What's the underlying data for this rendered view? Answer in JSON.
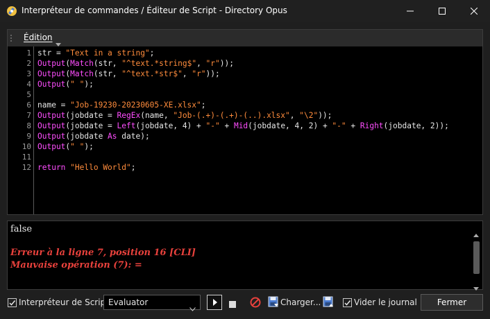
{
  "window": {
    "title": "Interpréteur de commandes / Éditeur de Script - Directory Opus"
  },
  "menu": {
    "edition_label": "Édition"
  },
  "editor": {
    "line_numbers": [
      "1",
      "2",
      "3",
      "4",
      "5",
      "6",
      "7",
      "8",
      "9",
      "10",
      "11",
      "12"
    ],
    "lines": [
      [
        [
          "plain",
          "str = "
        ],
        [
          "str",
          "\"Text in a string\""
        ],
        [
          "plain",
          ";"
        ]
      ],
      [
        [
          "func",
          "Output"
        ],
        [
          "plain",
          "("
        ],
        [
          "func",
          "Match"
        ],
        [
          "plain",
          "(str, "
        ],
        [
          "str",
          "\"^text.*string$\""
        ],
        [
          "plain",
          ", "
        ],
        [
          "str",
          "\"r\""
        ],
        [
          "plain",
          "));"
        ]
      ],
      [
        [
          "func",
          "Output"
        ],
        [
          "plain",
          "("
        ],
        [
          "func",
          "Match"
        ],
        [
          "plain",
          "(str, "
        ],
        [
          "str",
          "\"^text.*str$\""
        ],
        [
          "plain",
          ", "
        ],
        [
          "str",
          "\"r\""
        ],
        [
          "plain",
          "));"
        ]
      ],
      [
        [
          "func",
          "Output"
        ],
        [
          "plain",
          "("
        ],
        [
          "str",
          "\" \""
        ],
        [
          "plain",
          ");"
        ]
      ],
      [],
      [
        [
          "plain",
          "name = "
        ],
        [
          "str",
          "\"Job-19230-20230605-XE.xlsx\""
        ],
        [
          "plain",
          ";"
        ]
      ],
      [
        [
          "func",
          "Output"
        ],
        [
          "plain",
          "(jobdate = "
        ],
        [
          "func",
          "RegEx"
        ],
        [
          "plain",
          "(name, "
        ],
        [
          "str",
          "\"Job-(.+)-(.+)-(..).xlsx\""
        ],
        [
          "plain",
          ", "
        ],
        [
          "str",
          "\"\\2\""
        ],
        [
          "plain",
          "));"
        ]
      ],
      [
        [
          "func",
          "Output"
        ],
        [
          "plain",
          "(jobdate = "
        ],
        [
          "func",
          "Left"
        ],
        [
          "plain",
          "(jobdate, 4) + "
        ],
        [
          "str",
          "\"-\""
        ],
        [
          "plain",
          " + "
        ],
        [
          "func",
          "Mid"
        ],
        [
          "plain",
          "(jobdate, 4, 2) + "
        ],
        [
          "str",
          "\"-\""
        ],
        [
          "plain",
          " + "
        ],
        [
          "func",
          "Right"
        ],
        [
          "plain",
          "(jobdate, 2));"
        ]
      ],
      [
        [
          "func",
          "Output"
        ],
        [
          "plain",
          "(jobdate "
        ],
        [
          "kw",
          "As"
        ],
        [
          "plain",
          " date);"
        ]
      ],
      [
        [
          "func",
          "Output"
        ],
        [
          "plain",
          "("
        ],
        [
          "str",
          "\" \""
        ],
        [
          "plain",
          ");"
        ]
      ],
      [],
      [
        [
          "kw",
          "return"
        ],
        [
          "plain",
          " "
        ],
        [
          "str",
          "\"Hello World\""
        ],
        [
          "plain",
          ";"
        ]
      ]
    ]
  },
  "console": {
    "output_line": "false",
    "error_line_1": "Erreur à la ligne 7, position 16 [CLI]",
    "error_line_2": "Mauvaise opération (7): ="
  },
  "bottombar": {
    "script_interpreter_label": "Interpréteur de Script:",
    "script_interpreter_checked": true,
    "mode_value": "Evaluator",
    "load_label": "Charger...",
    "clear_log_label": "Vider le journal",
    "clear_log_checked": true,
    "close_label": "Fermer"
  },
  "colors": {
    "string": "#ff8c3c",
    "function": "#ff4dff",
    "error": "#e8413c"
  }
}
